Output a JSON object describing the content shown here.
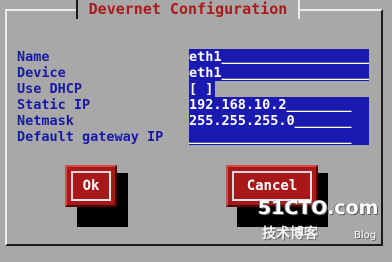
{
  "dialog": {
    "title": " Devernet Configuration "
  },
  "form": {
    "name": {
      "label": "Name",
      "value": "eth1____________________"
    },
    "device": {
      "label": "Device",
      "value": "eth1____________________"
    },
    "use_dhcp": {
      "label": "Use DHCP",
      "value": "[ ]"
    },
    "static_ip": {
      "label": "Static IP",
      "value": "192.168.10.2________"
    },
    "netmask": {
      "label": "Netmask",
      "value": "255.255.255.0_______"
    },
    "gateway": {
      "label": "Default gateway IP",
      "value": "____________________"
    }
  },
  "buttons": {
    "ok": "Ok",
    "cancel": "Cancel"
  },
  "watermark": {
    "main": "51CTO.com",
    "sub": "技术博客",
    "blog": "Blog"
  },
  "colors": {
    "background": "#a8a8a8",
    "label": "#1818a8",
    "field": "#1a1ab0",
    "title": "#aa1a1a",
    "button": "#a81818"
  }
}
